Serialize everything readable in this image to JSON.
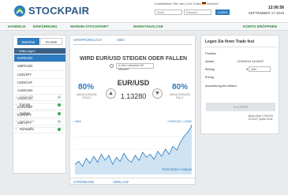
{
  "header": {
    "logo_text": "STOCKPAIR",
    "top_links": "Kontaktieren Sie uns | Live Chat |",
    "language": "Deutsch",
    "email_placeholder": "Email",
    "password_placeholder": "Passwort",
    "login_label": "LOGIN",
    "clock": "12:06:56",
    "date": "SEPTEMBER 17 2015"
  },
  "nav": {
    "items": [
      "HANDELN",
      "EINFÜHRUNG",
      "WARUM STOCKPAIR?",
      "MARKTANALYSE"
    ],
    "open_account": "KONTO ERÖFFNEN"
  },
  "sidebar": {
    "tabs": [
      "BINÄRE",
      "PAARE"
    ],
    "category_header": "Währungen",
    "assets": [
      "EUR/USD",
      "GBP/USD",
      "USD/JPY",
      "USD/CHF",
      "AUD/USD",
      "USD/CAD",
      "EUR/GBP",
      "EUR/JPY",
      "GBP/JPY"
    ],
    "active_asset_index": 0,
    "groups": [
      {
        "label": "Rohstoffe",
        "dim": true
      },
      {
        "label": "Europa",
        "dim": false
      },
      {
        "label": "Indizes",
        "dim": false
      },
      {
        "label": "Nordamer.",
        "dim": true
      },
      {
        "label": "Rohstoffe",
        "dim": false
      }
    ]
  },
  "main": {
    "tabs": [
      "URSPRÜNGLICH",
      "KBO"
    ],
    "question": "WIRD EUR/USD STEIGEN ODER FALLEN",
    "timeframe": "in den nächsten 60 Minuten",
    "pair": "EUR/USD",
    "rate": "1.13280",
    "up_pct": "80%",
    "up_sub": "WENN EUR/USD STEIGT",
    "down_pct": "80%",
    "down_sub": "WENN EUR/USD FÄLLT",
    "legend_left": "• SMA",
    "legend_right": "• EUR/USD 1.13280",
    "analysis_link": "Technische Analyse",
    "bottom_tabs": [
      "STRÖMUNG",
      "VERLAUF"
    ]
  },
  "chart_data": {
    "type": "line",
    "series": [
      {
        "values": [
          1.129,
          1.1293,
          1.1288,
          1.1296,
          1.1291,
          1.1298,
          1.1292,
          1.13,
          1.1294,
          1.1299,
          1.129,
          1.1297,
          1.1293,
          1.1301,
          1.1295,
          1.1292,
          1.1299,
          1.1294,
          1.1302,
          1.1297,
          1.13,
          1.1295,
          1.1303,
          1.1298,
          1.1305,
          1.13,
          1.1308,
          1.1304,
          1.1312,
          1.1318,
          1.1322,
          1.1328
        ]
      }
    ],
    "ylim": [
      1.128,
      1.133
    ],
    "grid": true
  },
  "trade": {
    "title": "Legen Sie Ihren Trade fest",
    "rows": [
      {
        "label": "Position",
        "value": ""
      },
      {
        "label": "Ablauf",
        "value": "17/9/2015 13:00:57"
      },
      {
        "label": "Betrag",
        "value": ""
      },
      {
        "label": "Ertrag",
        "value": ""
      },
      {
        "label": "Auszahlung bei Ablauf",
        "value": ""
      }
    ],
    "currency": "$",
    "amount": "100",
    "buy_label": "KAUFEN",
    "option_info": "Option Start 17/9/2015 12:00:57 Option Ende"
  },
  "colors": {
    "brand_blue": "#2e7bbf",
    "nav_green": "#2e8a3b",
    "chart_fill": "#cfe3f3"
  }
}
